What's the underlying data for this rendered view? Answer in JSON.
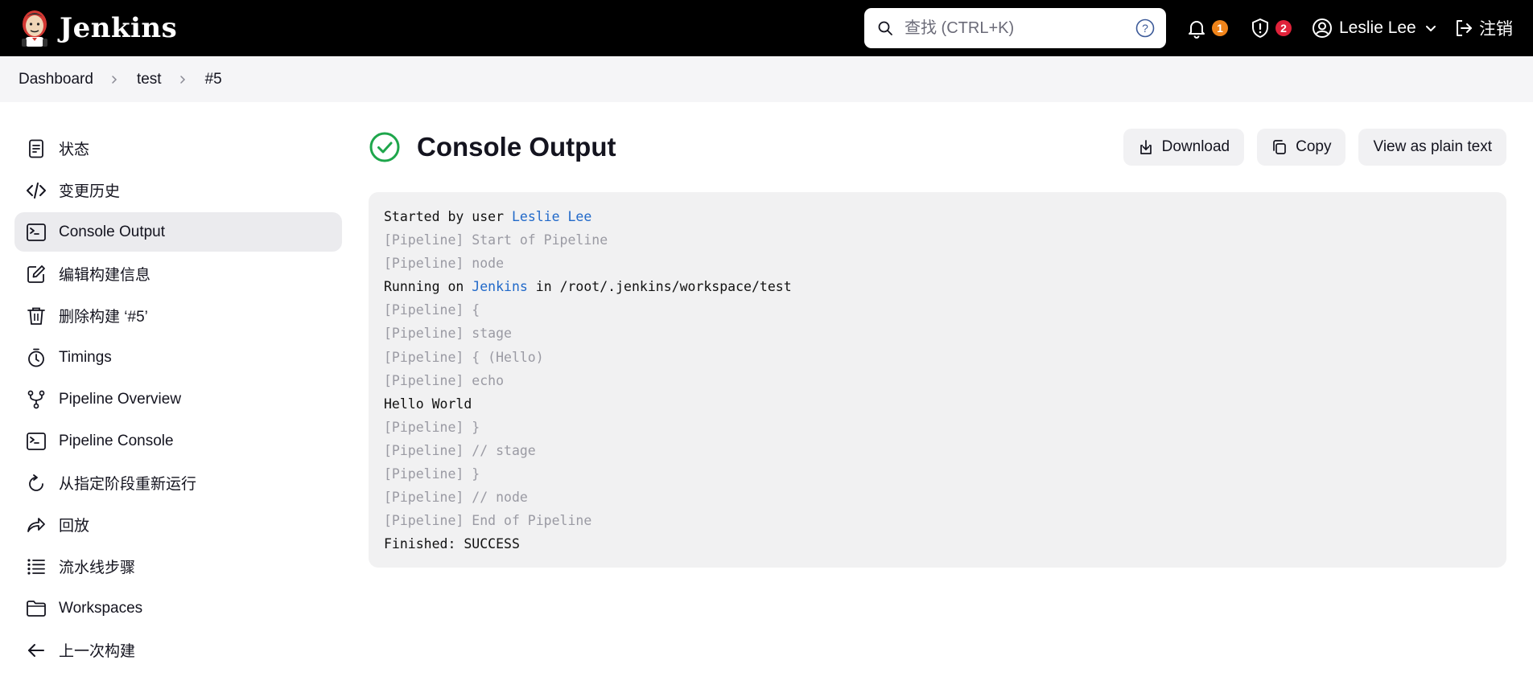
{
  "header": {
    "logo_text": "Jenkins",
    "search_placeholder": "查找 (CTRL+K)",
    "notifications_count": "1",
    "security_count": "2",
    "user_name": "Leslie Lee",
    "logout_label": "注销",
    "colors": {
      "bar": "#000000",
      "notif_badge": "#f0841a",
      "security_badge": "#e0223a"
    }
  },
  "breadcrumb": {
    "items": [
      "Dashboard",
      "test",
      "#5"
    ]
  },
  "sidebar": {
    "items": [
      {
        "label": "状态",
        "icon": "document-icon"
      },
      {
        "label": "变更历史",
        "icon": "code-icon"
      },
      {
        "label": "Console Output",
        "icon": "terminal-icon",
        "active": true
      },
      {
        "label": "编辑构建信息",
        "icon": "edit-icon"
      },
      {
        "label": "删除构建 ‘#5’",
        "icon": "trash-icon"
      },
      {
        "label": "Timings",
        "icon": "stopwatch-icon"
      },
      {
        "label": "Pipeline Overview",
        "icon": "branch-icon"
      },
      {
        "label": "Pipeline Console",
        "icon": "terminal-icon"
      },
      {
        "label": "从指定阶段重新运行",
        "icon": "rerun-icon"
      },
      {
        "label": "回放",
        "icon": "replay-icon"
      },
      {
        "label": "流水线步骤",
        "icon": "list-icon"
      },
      {
        "label": "Workspaces",
        "icon": "folder-icon"
      },
      {
        "label": "上一次构建",
        "icon": "arrow-left-icon"
      }
    ]
  },
  "main": {
    "title": "Console Output",
    "status_color": "#1ea64b",
    "actions": {
      "download": "Download",
      "copy": "Copy",
      "plain_text": "View as plain text"
    }
  },
  "console": {
    "link_color": "#2169c9",
    "lines": [
      {
        "prefix": "Started by user ",
        "link": "Leslie Lee",
        "suffix": "",
        "type": "normal"
      },
      {
        "text": "[Pipeline] Start of Pipeline",
        "type": "pipeline"
      },
      {
        "text": "[Pipeline] node",
        "type": "pipeline"
      },
      {
        "prefix": "Running on ",
        "link": "Jenkins",
        "suffix": " in /root/.jenkins/workspace/test",
        "type": "normal"
      },
      {
        "text": "[Pipeline] {",
        "type": "pipeline"
      },
      {
        "text": "[Pipeline] stage",
        "type": "pipeline"
      },
      {
        "text": "[Pipeline] { (Hello)",
        "type": "pipeline"
      },
      {
        "text": "[Pipeline] echo",
        "type": "pipeline"
      },
      {
        "text": "Hello World",
        "type": "normal"
      },
      {
        "text": "[Pipeline] }",
        "type": "pipeline"
      },
      {
        "text": "[Pipeline] // stage",
        "type": "pipeline"
      },
      {
        "text": "[Pipeline] }",
        "type": "pipeline"
      },
      {
        "text": "[Pipeline] // node",
        "type": "pipeline"
      },
      {
        "text": "[Pipeline] End of Pipeline",
        "type": "pipeline"
      },
      {
        "text": "Finished: SUCCESS",
        "type": "normal"
      }
    ]
  }
}
